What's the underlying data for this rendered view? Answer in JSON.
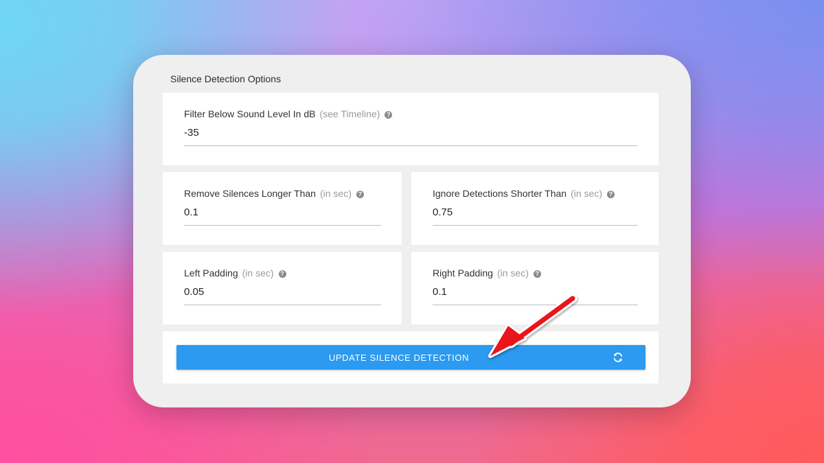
{
  "panel": {
    "title": "Silence Detection Options"
  },
  "fields": {
    "filter_sound_level": {
      "label": "Filter Below Sound Level In dB",
      "hint": "(see Timeline)",
      "value": "-35"
    },
    "remove_silences": {
      "label": "Remove Silences Longer Than",
      "hint": "(in sec)",
      "value": "0.1"
    },
    "ignore_detections": {
      "label": "Ignore Detections Shorter Than",
      "hint": "(in sec)",
      "value": "0.75"
    },
    "left_padding": {
      "label": "Left Padding",
      "hint": "(in sec)",
      "value": "0.05"
    },
    "right_padding": {
      "label": "Right Padding",
      "hint": "(in sec)",
      "value": "0.1"
    }
  },
  "help_icon_glyph": "?",
  "update_button": {
    "label": "UPDATE SILENCE DETECTION",
    "icon": "refresh-icon"
  },
  "colors": {
    "button": "#2b9af0",
    "arrow": "#e8141b",
    "panel": "#efefef"
  }
}
